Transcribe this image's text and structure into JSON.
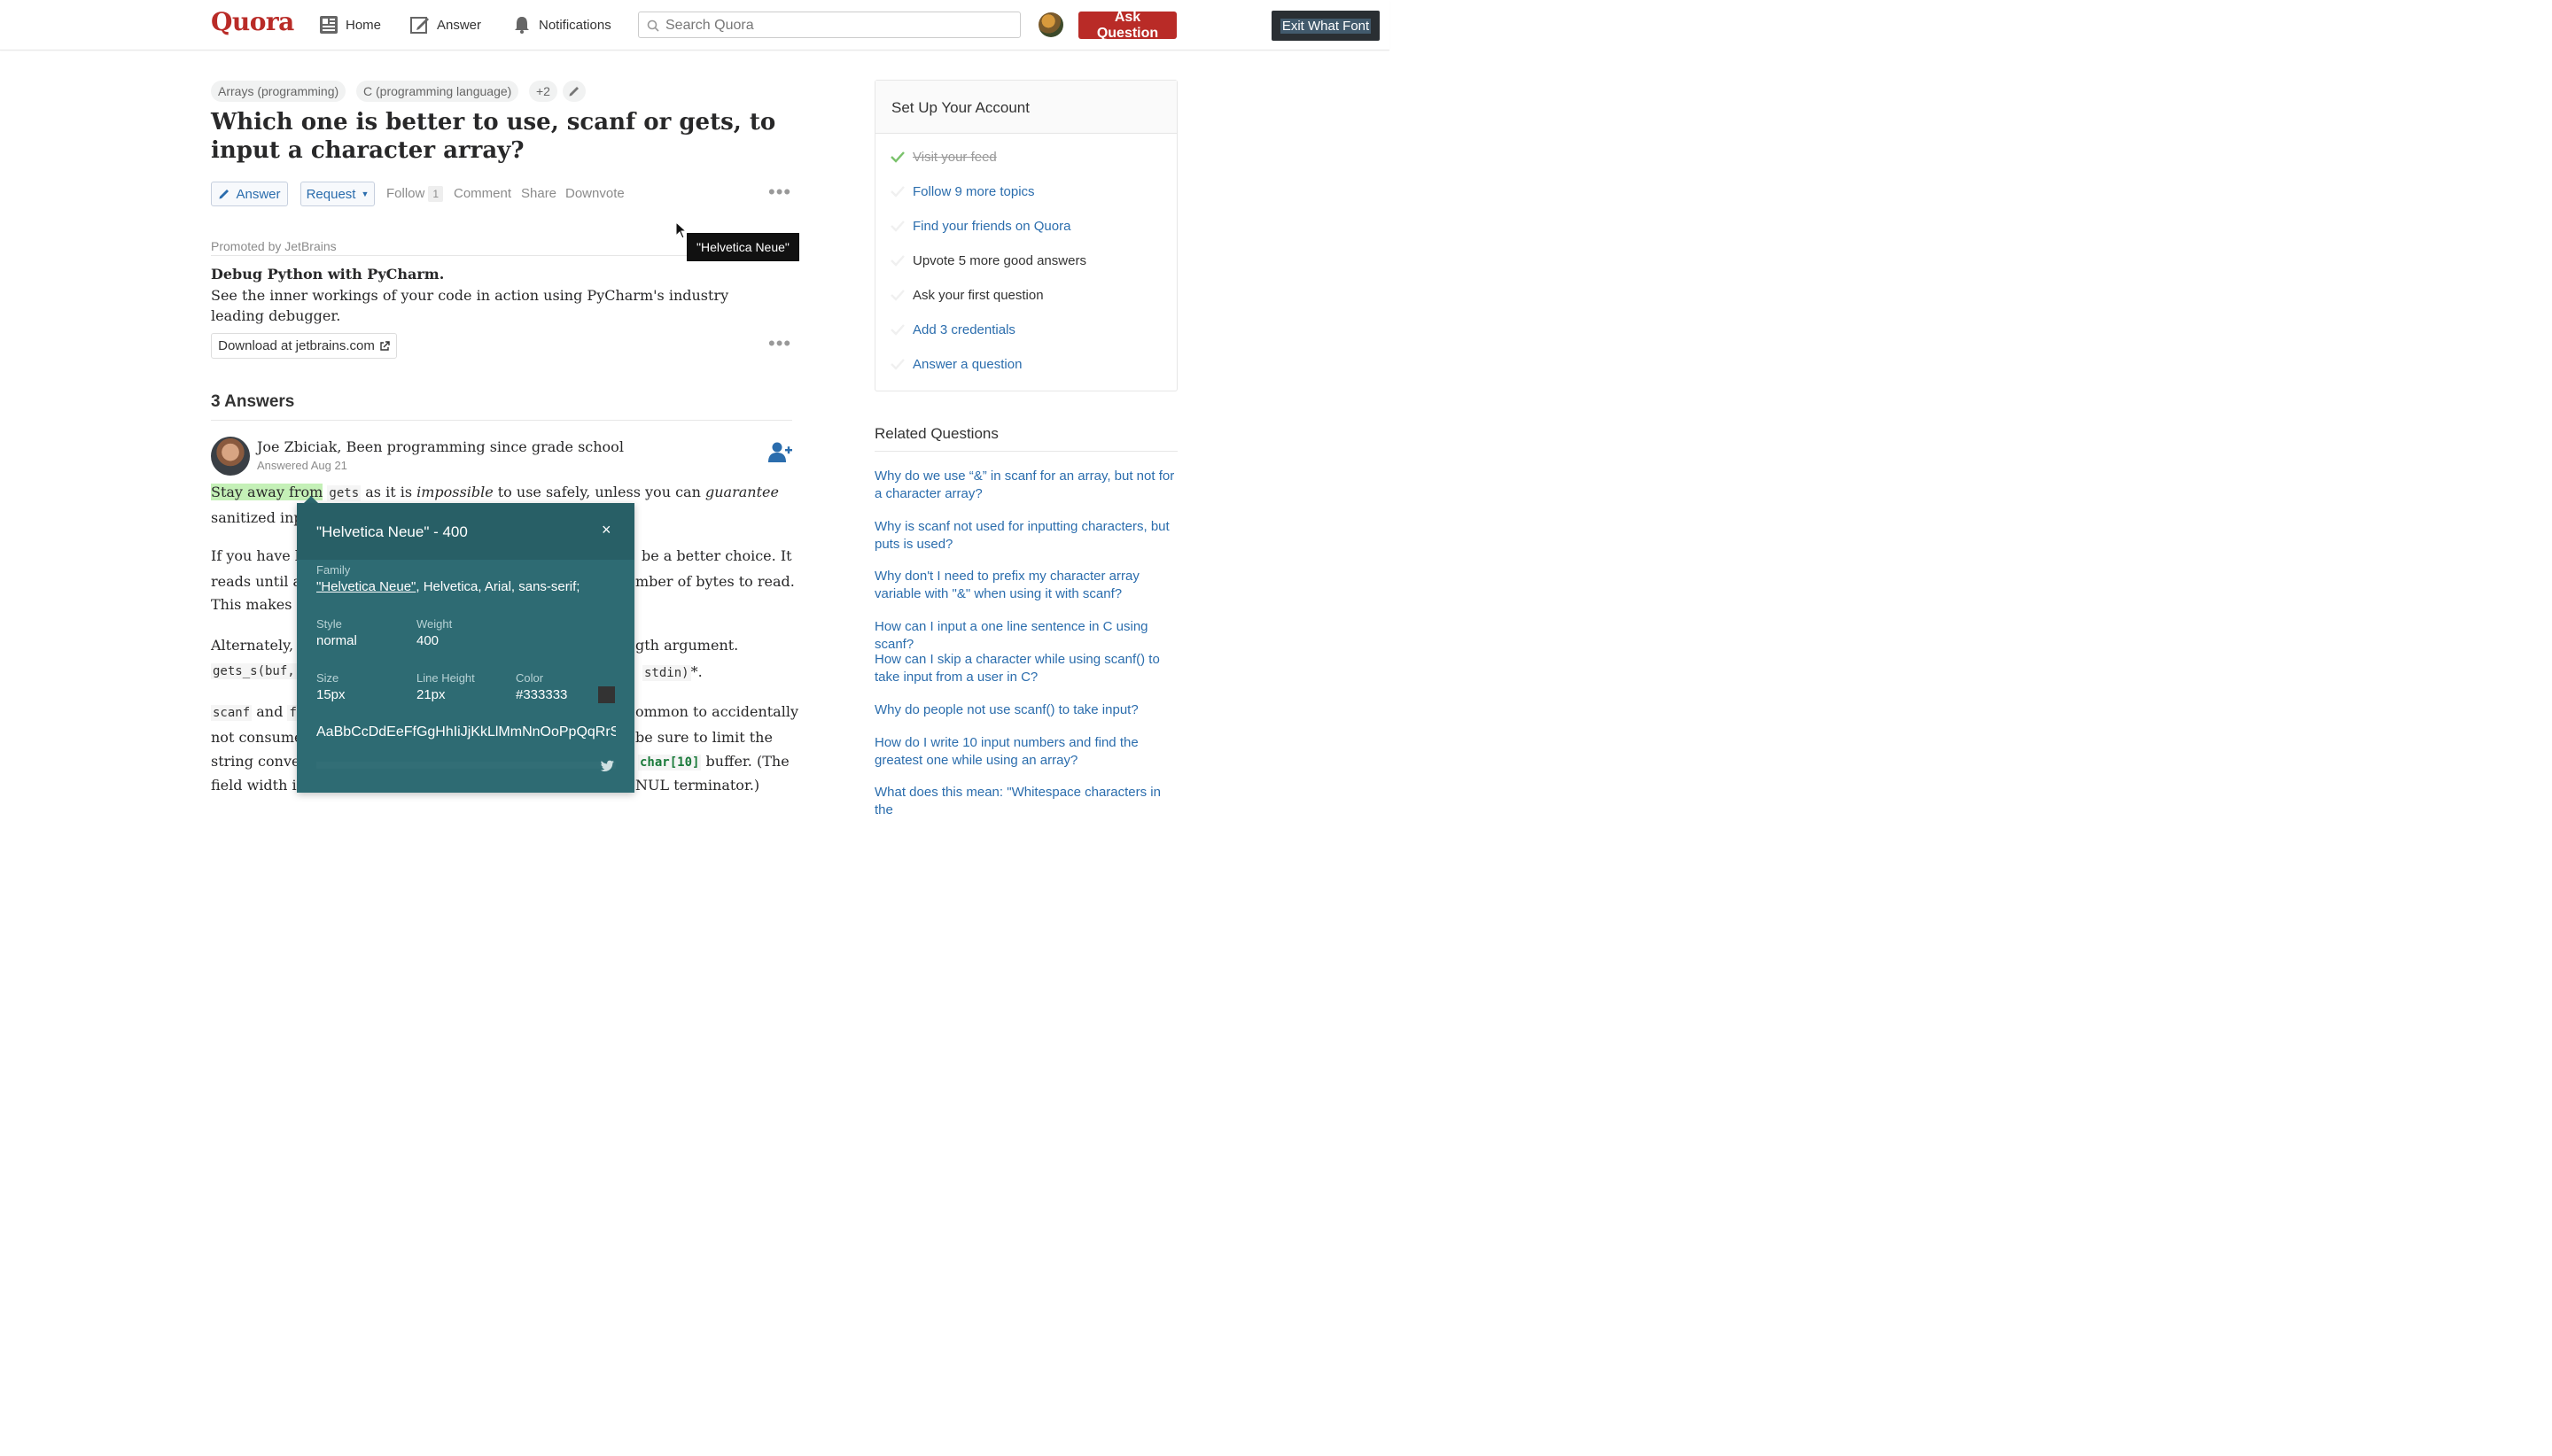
{
  "header": {
    "logo": "Quora",
    "nav": [
      {
        "label": "Home",
        "icon": "home-icon"
      },
      {
        "label": "Answer",
        "icon": "pencil-icon"
      },
      {
        "label": "Notifications",
        "icon": "bell-icon"
      }
    ],
    "search_placeholder": "Search Quora",
    "ask_button": "Ask Question",
    "exit_button": "Exit What Font"
  },
  "question": {
    "topics": [
      "Arrays (programming)",
      "C (programming language)",
      "+2"
    ],
    "title": "Which one is better to use, scanf or gets, to input a character array?",
    "actions": {
      "answer": "Answer",
      "request": "Request",
      "follow": "Follow",
      "follow_count": "1",
      "comment": "Comment",
      "share": "Share",
      "downvote": "Downvote"
    }
  },
  "promo": {
    "label": "Promoted by JetBrains",
    "title": "Debug Python with PyCharm.",
    "text": "See the inner workings of your code in action using PyCharm's industry leading debugger.",
    "link": "Download at jetbrains.com"
  },
  "answers": {
    "count_label": "3 Answers",
    "first": {
      "author": "Joe Zbiciak, Been programming since grade school",
      "date": "Answered Aug 21",
      "p1": {
        "hl": "Stay away from",
        "code": "gets",
        "a": "as it is",
        "em1": "impossible",
        "b": "to use safely, unless you can",
        "em2": "guarantee"
      },
      "p1_line2": "sanitized inp",
      "p2_l1a": "If you have li",
      "p2_l1b": "be a better choice. It",
      "p2_l2a": "reads until a",
      "p2_l2b": "mber of bytes to read.",
      "p2_l3a": "This makes i",
      "p3_l1a": "Alternately,",
      "p3_l1b": "gth argument.",
      "p3_l2_code_a": "gets_s(buf,",
      "p3_l2_code_b": "stdin)",
      "p3_l2_tail": "*.",
      "p4_l1_code": "scanf",
      "p4_l1_and": "and",
      "p4_l1_code2": "fs",
      "p4_l1b": "ommon to accidentally",
      "p4_l2a": "not consume",
      "p4_l2b": "be sure to limit the",
      "p4_l3a": "string conver",
      "p4_l3_code": "char[10]",
      "p4_l3b": "buffer. (The",
      "p4_l4a": "field width is",
      "p4_l4b": "NUL terminator.)"
    }
  },
  "tooltip": "\"Helvetica Neue\"",
  "font_panel": {
    "title": "\"Helvetica Neue\" - 400",
    "close": "×",
    "family_label": "Family",
    "family_primary": "\"Helvetica Neue\"",
    "family_rest": ", Helvetica, Arial, sans-serif;",
    "style_label": "Style",
    "style_value": "normal",
    "weight_label": "Weight",
    "weight_value": "400",
    "size_label": "Size",
    "size_value": "15px",
    "line_height_label": "Line Height",
    "line_height_value": "21px",
    "color_label": "Color",
    "color_value": "#333333",
    "sample": "AaBbCcDdEeFfGgHhIiJjKkLlMmNnOoPpQqRrSsTtUuVvWwXxYyZz"
  },
  "sidebar": {
    "setup_title": "Set Up Your Account",
    "setup_items": [
      {
        "label": "Visit your feed",
        "state": "done"
      },
      {
        "label": "Follow 9 more topics",
        "state": "link"
      },
      {
        "label": "Find your friends on Quora",
        "state": "link"
      },
      {
        "label": "Upvote 5 more good answers",
        "state": "plain"
      },
      {
        "label": "Ask your first question",
        "state": "plain"
      },
      {
        "label": "Add 3 credentials",
        "state": "link"
      },
      {
        "label": "Answer a question",
        "state": "link"
      }
    ],
    "related_title": "Related Questions",
    "related": [
      "Why do we use “&” in scanf for an array, but not for a character array?",
      "Why is scanf not used for inputting characters, but puts is used?",
      "Why don't I need to prefix my character array variable with \"&\" when using it with scanf?",
      "How can I input a one line sentence in C using scanf?",
      "How can I skip a character while using scanf() to take input from a user in C?",
      "Why do people not use scanf() to take input?",
      "How do I write 10 input numbers and find the greatest one while using an array?",
      "What does this mean: \"Whitespace characters in the"
    ]
  },
  "colors": {
    "brand": "#b92b27",
    "link": "#2b6dad",
    "panel": "#2e6b73",
    "highlight": "#c4f0b7"
  }
}
